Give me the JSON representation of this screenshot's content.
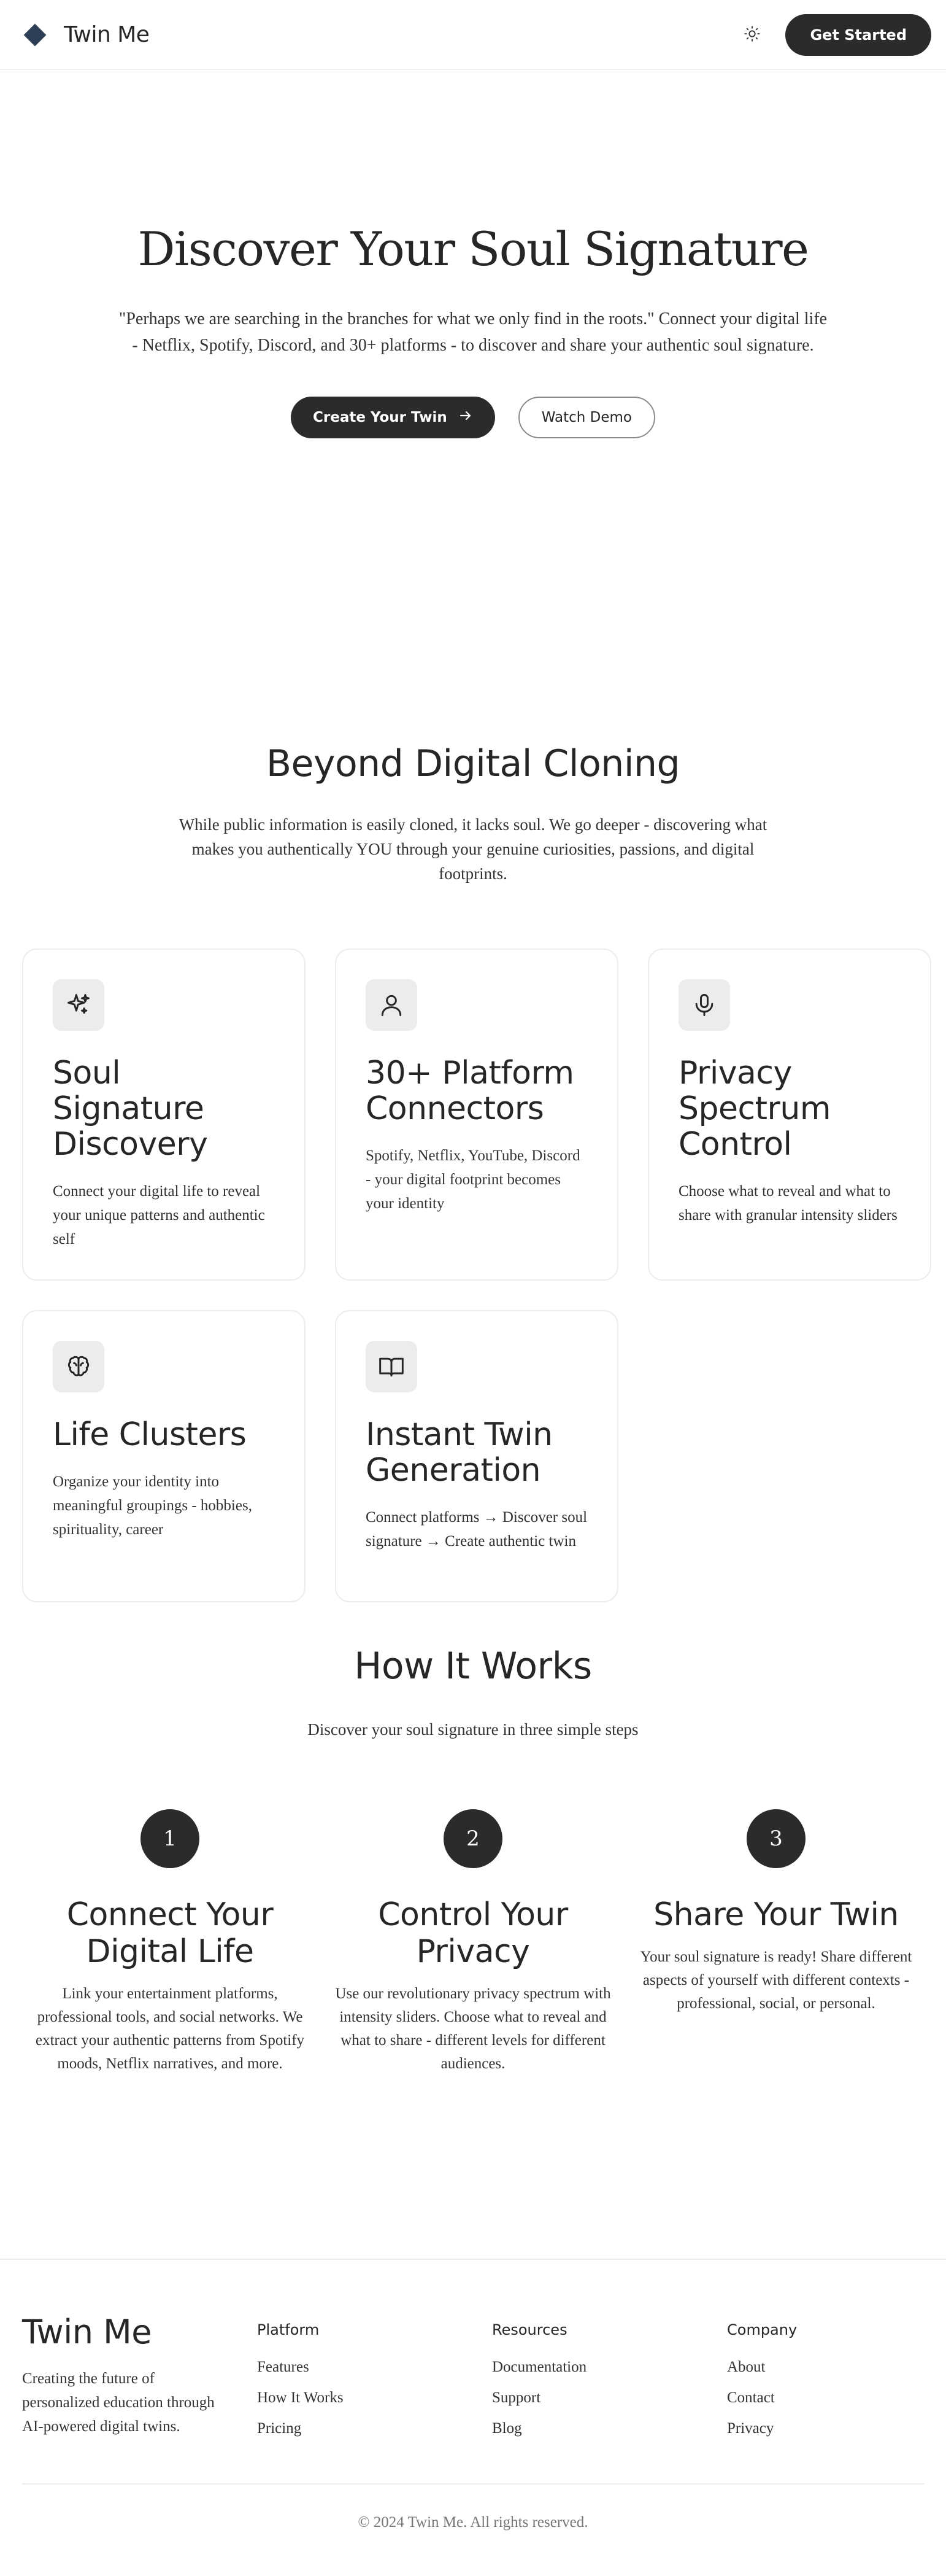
{
  "header": {
    "brand": "Twin Me",
    "cta": "Get Started",
    "logo_icon": "diamond-logo-icon",
    "theme_icon": "sun-icon"
  },
  "hero": {
    "title": "Discover Your Soul Signature",
    "quote": "\"Perhaps we are searching in the branches for what we only find in the roots.\" Connect your digital life - Netflix, Spotify, Discord, and 30+ platforms - to discover and share your authentic soul signature.",
    "primary_button": "Create Your Twin",
    "secondary_button": "Watch Demo"
  },
  "beyond": {
    "title": "Beyond Digital Cloning",
    "subtitle": "While public information is easily cloned, it lacks soul. We go deeper - discovering what makes you authentically YOU through your genuine curiosities, passions, and digital footprints.",
    "features": [
      {
        "icon": "sparkles-icon",
        "title": "Soul Signature Discovery",
        "description": "Connect your digital life to reveal your unique patterns and authentic self"
      },
      {
        "icon": "user-icon",
        "title": "30+ Platform Connectors",
        "description": "Spotify, Netflix, YouTube, Discord - your digital footprint becomes your identity"
      },
      {
        "icon": "microphone-icon",
        "title": "Privacy Spectrum Control",
        "description": "Choose what to reveal and what to share with granular intensity sliders"
      },
      {
        "icon": "brain-icon",
        "title": "Life Clusters",
        "description": "Organize your identity into meaningful groupings - hobbies, spirituality, career"
      },
      {
        "icon": "book-open-icon",
        "title": "Instant Twin Generation",
        "description": "Connect platforms → Discover soul signature → Create authentic twin"
      }
    ]
  },
  "how": {
    "title": "How It Works",
    "subtitle": "Discover your soul signature in three simple steps",
    "steps": [
      {
        "number": "1",
        "title": "Connect Your Digital Life",
        "description": "Link your entertainment platforms, professional tools, and social networks. We extract your authentic patterns from Spotify moods, Netflix narratives, and more."
      },
      {
        "number": "2",
        "title": "Control Your Privacy",
        "description": "Use our revolutionary privacy spectrum with intensity sliders. Choose what to reveal and what to share - different levels for different audiences."
      },
      {
        "number": "3",
        "title": "Share Your Twin",
        "description": "Your soul signature is ready! Share different aspects of yourself with different contexts - professional, social, or personal."
      }
    ]
  },
  "footer": {
    "brand": "Twin Me",
    "tagline": "Creating the future of personalized education through AI-powered digital twins.",
    "columns": [
      {
        "title": "Platform",
        "links": [
          "Features",
          "How It Works",
          "Pricing"
        ]
      },
      {
        "title": "Resources",
        "links": [
          "Documentation",
          "Support",
          "Blog"
        ]
      },
      {
        "title": "Company",
        "links": [
          "About",
          "Contact",
          "Privacy"
        ]
      }
    ],
    "copyright": "© 2024 Twin Me. All rights reserved."
  },
  "colors": {
    "primary": "#2b2b2b",
    "logo": "#2c3e55",
    "card_border": "#ececec",
    "icon_bg": "#ececec"
  }
}
